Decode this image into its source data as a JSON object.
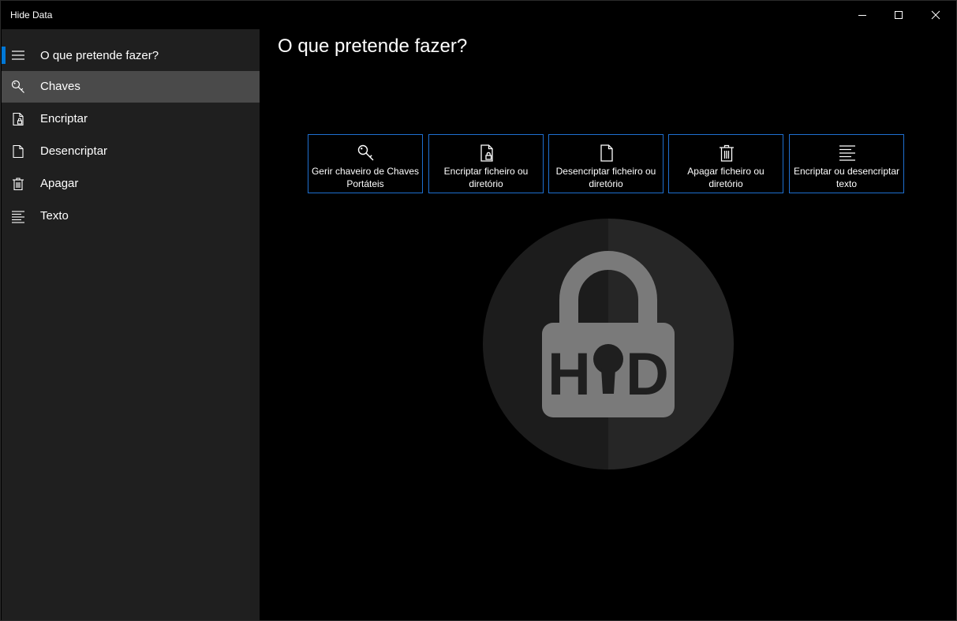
{
  "window": {
    "title": "Hide Data"
  },
  "sidebar": {
    "items": [
      {
        "label": "O que pretende fazer?",
        "icon": "hamburger-icon"
      },
      {
        "label": "Chaves",
        "icon": "key-icon",
        "selected": true
      },
      {
        "label": "Encriptar",
        "icon": "encrypt-file-icon"
      },
      {
        "label": "Desencriptar",
        "icon": "file-icon"
      },
      {
        "label": "Apagar",
        "icon": "trash-icon"
      },
      {
        "label": "Texto",
        "icon": "text-align-icon"
      }
    ]
  },
  "main": {
    "title": "O que pretende fazer?",
    "actions": [
      {
        "label": "Gerir chaveiro de Chaves Portáteis",
        "icon": "key-icon"
      },
      {
        "label": "Encriptar ficheiro ou diretório",
        "icon": "encrypt-file-icon"
      },
      {
        "label": "Desencriptar ficheiro ou diretório",
        "icon": "file-icon"
      },
      {
        "label": "Apagar ficheiro ou diretório",
        "icon": "trash-icon"
      },
      {
        "label": "Encriptar ou desencriptar texto",
        "icon": "text-align-icon"
      }
    ],
    "logo": {
      "text": "HD",
      "icon": "padlock-logo"
    }
  },
  "colors": {
    "accent": "#0078d7",
    "sidebar_bg": "#1f1f1f",
    "selected_bg": "#4a4a4a",
    "content_bg": "#000000",
    "action_border": "#1e6fd0",
    "logo_circle_left": "#1c1c1c",
    "logo_circle_right": "#262626",
    "logo_lock": "#7a7a7a"
  }
}
